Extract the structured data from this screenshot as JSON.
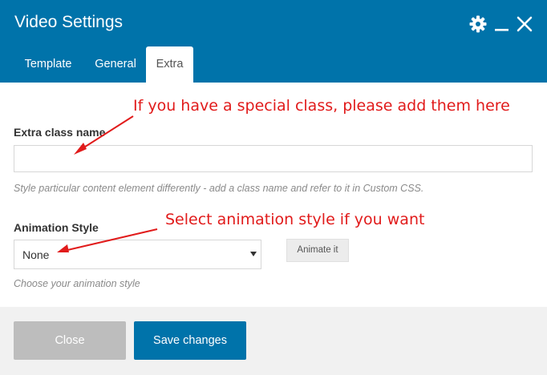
{
  "dialog": {
    "title": "Video Settings",
    "colors": {
      "header": "#0073aa",
      "primary_button": "#0073aa",
      "disabled_button": "#bdbdbd",
      "annotation": "#e11b1b"
    }
  },
  "header_icons": [
    "gear-icon",
    "minimize-icon",
    "close-icon"
  ],
  "tabs": [
    {
      "label": "Template",
      "active": false
    },
    {
      "label": "General",
      "active": false
    },
    {
      "label": "Extra",
      "active": true
    }
  ],
  "fields": {
    "extra_class": {
      "label": "Extra class name",
      "value": "",
      "help": "Style particular content element differently - add a class name and refer to it in Custom CSS."
    },
    "animation": {
      "label": "Animation Style",
      "selected": "None",
      "help": "Choose your animation style",
      "animate_button": "Animate it"
    }
  },
  "annotations": {
    "class_note": "If you have a special class, please add them here",
    "animation_note": "Select animation style if you want"
  },
  "footer": {
    "close_label": "Close",
    "save_label": "Save changes"
  }
}
